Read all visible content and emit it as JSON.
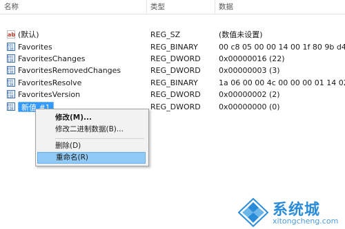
{
  "columns": {
    "name": "名称",
    "type": "类型",
    "data": "数据"
  },
  "rows": [
    {
      "icon": "string-value-icon",
      "name": "(默认)",
      "type": "REG_SZ",
      "data": "(数值未设置)"
    },
    {
      "icon": "binary-value-icon",
      "name": "Favorites",
      "type": "REG_BINARY",
      "data": "00 c8 05 00 00 14 00 1f 80 9b d4 34 4"
    },
    {
      "icon": "binary-value-icon",
      "name": "FavoritesChanges",
      "type": "REG_DWORD",
      "data": "0x00000016 (22)"
    },
    {
      "icon": "binary-value-icon",
      "name": "FavoritesRemovedChanges",
      "type": "REG_DWORD",
      "data": "0x00000003 (3)"
    },
    {
      "icon": "binary-value-icon",
      "name": "FavoritesResolve",
      "type": "REG_BINARY",
      "data": "1a 06 00 00 4c 00 00 00 01 14 02 00 0"
    },
    {
      "icon": "binary-value-icon",
      "name": "FavoritesVersion",
      "type": "REG_DWORD",
      "data": "0x00000002 (2)"
    },
    {
      "icon": "binary-value-icon",
      "name": "新值 #1",
      "type": "REG_DWORD",
      "data": "0x00000000 (0)"
    }
  ],
  "context_menu": {
    "modify": "修改(M)...",
    "modify_binary": "修改二进制数据(B)...",
    "delete": "删除(D)",
    "rename": "重命名(R)"
  },
  "watermark": {
    "brand": "系统城",
    "url": "xitongcheng.com"
  }
}
